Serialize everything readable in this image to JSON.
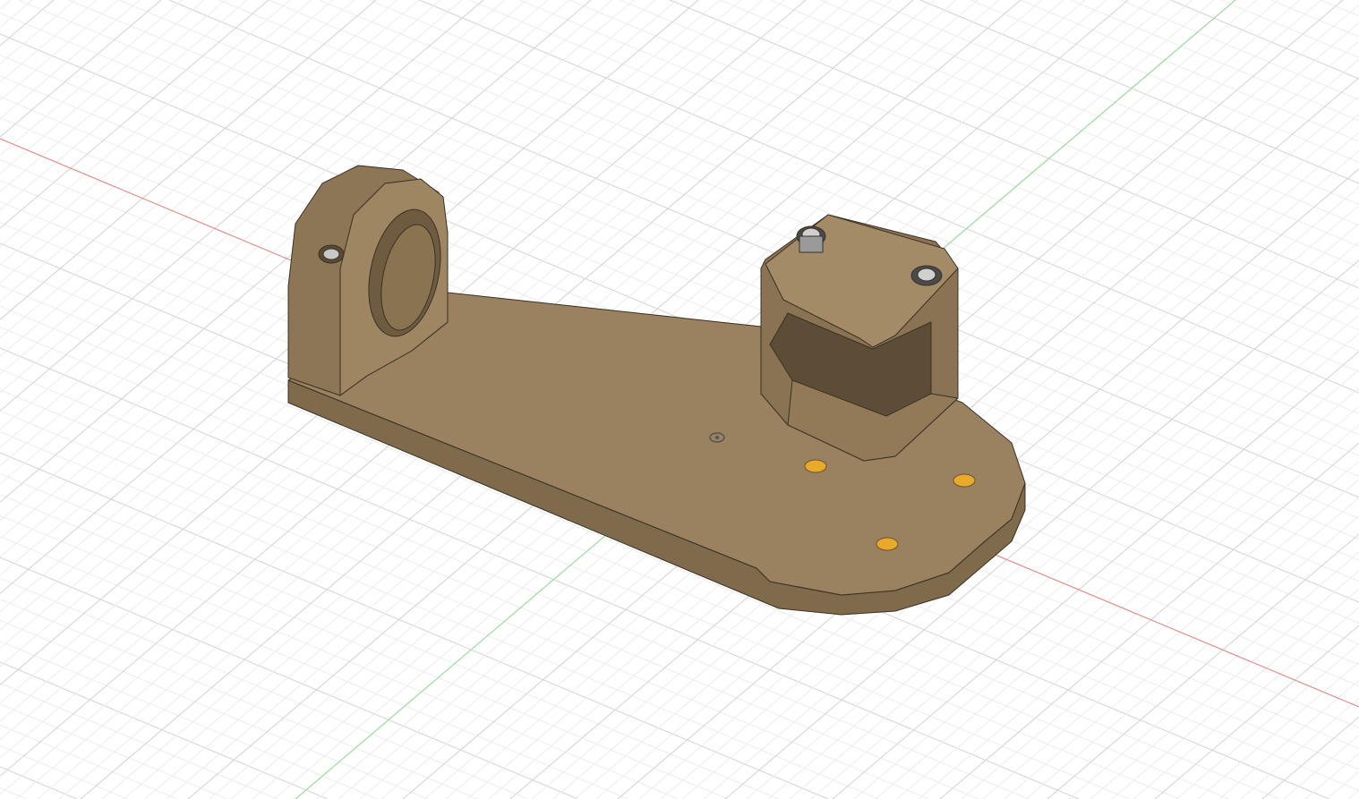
{
  "viewport": {
    "background_color": "#ffffff",
    "grid_minor_color": "#ececec",
    "grid_major_color": "#d2d2d2",
    "x_axis_color": "#e8807a",
    "y_axis_color": "#8fdc8a",
    "model_color": "#9a8260",
    "model_side_color": "#7f6a4c",
    "model_top_color": "#a48b68",
    "hole_color": "#e9a92a"
  },
  "icons": [
    "origin-icon",
    "screw-icon"
  ]
}
